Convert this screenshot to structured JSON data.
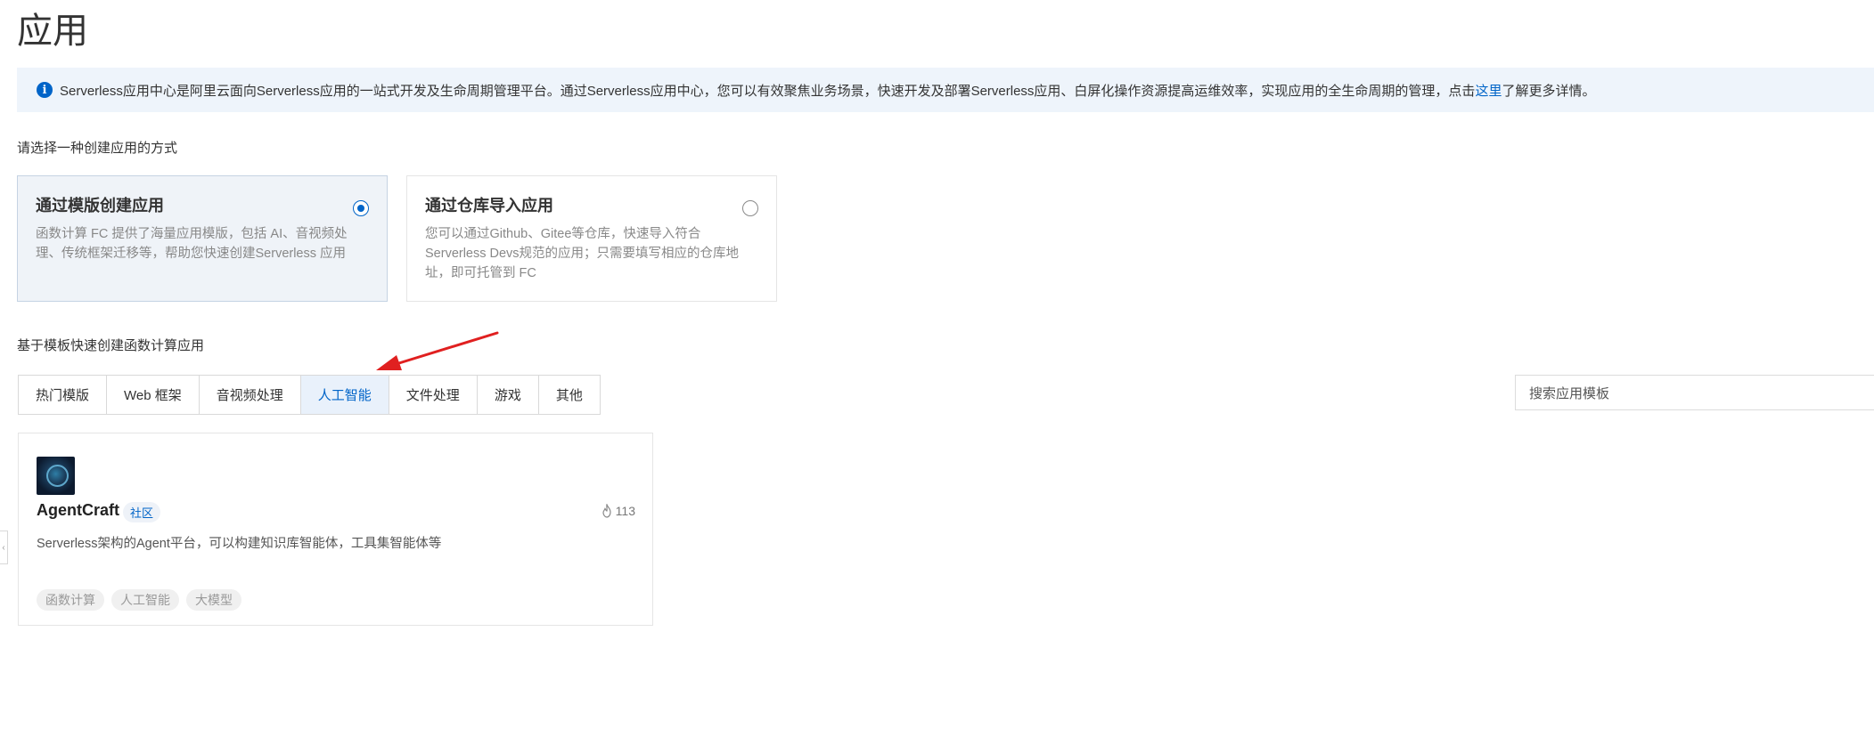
{
  "page": {
    "title": "应用"
  },
  "info": {
    "text_before": "Serverless应用中心是阿里云面向Serverless应用的一站式开发及生命周期管理平台。通过Serverless应用中心，您可以有效聚焦业务场景，快速开发及部署Serverless应用、白屏化操作资源提高运维效率，实现应用的全生命周期的管理，点击",
    "link": "这里",
    "text_after": "了解更多详情。"
  },
  "create_mode": {
    "label": "请选择一种创建应用的方式",
    "options": [
      {
        "title": "通过模版创建应用",
        "description": "函数计算 FC 提供了海量应用模版，包括 AI、音视频处理、传统框架迁移等，帮助您快速创建Serverless 应用",
        "selected": true
      },
      {
        "title": "通过仓库导入应用",
        "description": "您可以通过Github、Gitee等仓库，快速导入符合 Serverless Devs规范的应用；只需要填写相应的仓库地址，即可托管到 FC",
        "selected": false
      }
    ]
  },
  "templates": {
    "label": "基于模板快速创建函数计算应用",
    "tabs": [
      "热门模版",
      "Web 框架",
      "音视频处理",
      "人工智能",
      "文件处理",
      "游戏",
      "其他"
    ],
    "active_tab": "人工智能",
    "search_placeholder": "搜索应用模板",
    "apps": [
      {
        "name": "AgentCraft",
        "badge": "社区",
        "hot_count": "113",
        "description": "Serverless架构的Agent平台，可以构建知识库智能体，工具集智能体等",
        "tags": [
          "函数计算",
          "人工智能",
          "大模型"
        ]
      }
    ]
  },
  "colors": {
    "accent": "#0064c8",
    "annotation_arrow": "#e02020"
  },
  "icons": {
    "info": "info-icon",
    "hot": "flame-icon",
    "handle": "chevron-left-icon"
  }
}
